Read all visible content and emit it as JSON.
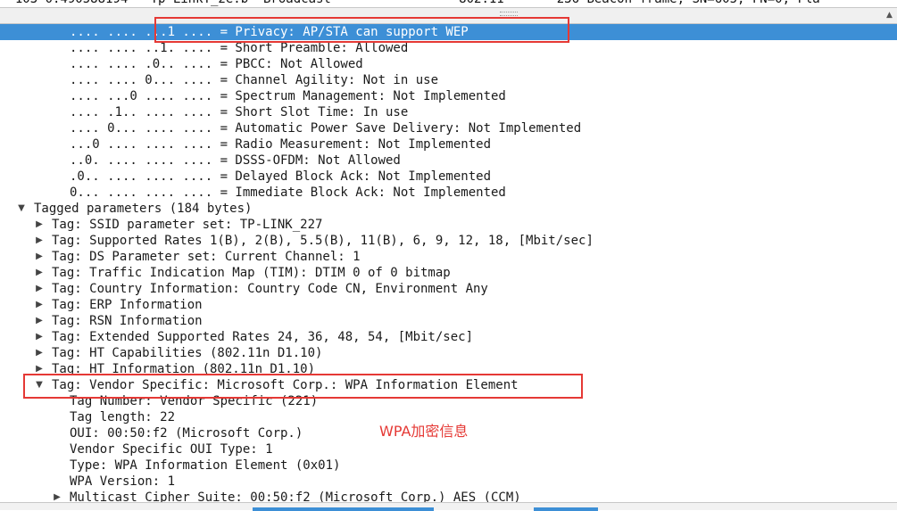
{
  "packet_list": {
    "partial_row": "  103 0.490588194   Tp-LinkT_2e:b  Broadcast                 802.11       236 Beacon frame, SN=605, FN=0, Fla"
  },
  "tree": {
    "rows": [
      {
        "indent": 78,
        "expander": "none",
        "text": ".... .... ...1 .... = Privacy: AP/STA can support WEP",
        "selected": true
      },
      {
        "indent": 78,
        "expander": "none",
        "text": ".... .... ..1. .... = Short Preamble: Allowed"
      },
      {
        "indent": 78,
        "expander": "none",
        "text": ".... .... .0.. .... = PBCC: Not Allowed"
      },
      {
        "indent": 78,
        "expander": "none",
        "text": ".... .... 0... .... = Channel Agility: Not in use"
      },
      {
        "indent": 78,
        "expander": "none",
        "text": ".... ...0 .... .... = Spectrum Management: Not Implemented"
      },
      {
        "indent": 78,
        "expander": "none",
        "text": ".... .1.. .... .... = Short Slot Time: In use"
      },
      {
        "indent": 78,
        "expander": "none",
        "text": ".... 0... .... .... = Automatic Power Save Delivery: Not Implemented"
      },
      {
        "indent": 78,
        "expander": "none",
        "text": "...0 .... .... .... = Radio Measurement: Not Implemented"
      },
      {
        "indent": 78,
        "expander": "none",
        "text": "..0. .... .... .... = DSSS-OFDM: Not Allowed"
      },
      {
        "indent": 78,
        "expander": "none",
        "text": ".0.. .... .... .... = Delayed Block Ack: Not Implemented"
      },
      {
        "indent": 78,
        "expander": "none",
        "text": "0... .... .... .... = Immediate Block Ack: Not Implemented"
      },
      {
        "indent": 38,
        "expander": "expanded",
        "text": "Tagged parameters (184 bytes)"
      },
      {
        "indent": 58,
        "expander": "collapsed",
        "text": "Tag: SSID parameter set: TP-LINK_227"
      },
      {
        "indent": 58,
        "expander": "collapsed",
        "text": "Tag: Supported Rates 1(B), 2(B), 5.5(B), 11(B), 6, 9, 12, 18, [Mbit/sec]"
      },
      {
        "indent": 58,
        "expander": "collapsed",
        "text": "Tag: DS Parameter set: Current Channel: 1"
      },
      {
        "indent": 58,
        "expander": "collapsed",
        "text": "Tag: Traffic Indication Map (TIM): DTIM 0 of 0 bitmap"
      },
      {
        "indent": 58,
        "expander": "collapsed",
        "text": "Tag: Country Information: Country Code CN, Environment Any"
      },
      {
        "indent": 58,
        "expander": "collapsed",
        "text": "Tag: ERP Information"
      },
      {
        "indent": 58,
        "expander": "collapsed",
        "text": "Tag: RSN Information"
      },
      {
        "indent": 58,
        "expander": "collapsed",
        "text": "Tag: Extended Supported Rates 24, 36, 48, 54, [Mbit/sec]"
      },
      {
        "indent": 58,
        "expander": "collapsed",
        "text": "Tag: HT Capabilities (802.11n D1.10)"
      },
      {
        "indent": 58,
        "expander": "collapsed",
        "text": "Tag: HT Information (802.11n D1.10)"
      },
      {
        "indent": 58,
        "expander": "expanded",
        "text": "Tag: Vendor Specific: Microsoft Corp.: WPA Information Element"
      },
      {
        "indent": 78,
        "expander": "none",
        "text": "Tag Number: Vendor Specific (221)"
      },
      {
        "indent": 78,
        "expander": "none",
        "text": "Tag length: 22"
      },
      {
        "indent": 78,
        "expander": "none",
        "text": "OUI: 00:50:f2 (Microsoft Corp.)"
      },
      {
        "indent": 78,
        "expander": "none",
        "text": "Vendor Specific OUI Type: 1"
      },
      {
        "indent": 78,
        "expander": "none",
        "text": "Type: WPA Information Element (0x01)"
      },
      {
        "indent": 78,
        "expander": "none",
        "text": "WPA Version: 1"
      },
      {
        "indent": 78,
        "expander": "collapsed",
        "text": "Multicast Cipher Suite: 00:50:f2 (Microsoft Corp.) AES (CCM)"
      }
    ]
  },
  "annotation": {
    "label": "WPA加密信息",
    "color": "#e53935"
  },
  "colors": {
    "selection": "#3d8fd6",
    "highlight_box": "#e53935"
  }
}
